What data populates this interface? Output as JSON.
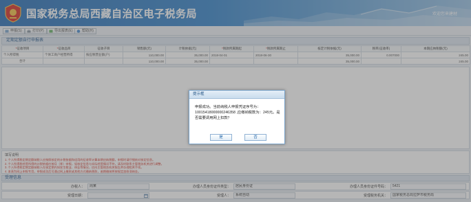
{
  "header": {
    "site_title": "国家税务总局西藏自治区电子税务局",
    "welcome": "欢迎您来建材"
  },
  "toolbar": {
    "buttons": [
      {
        "label": "申报(S)"
      },
      {
        "label": "打印(P)"
      },
      {
        "label": "导出报表(E)"
      },
      {
        "label": "帮助(H)"
      }
    ]
  },
  "form": {
    "title": "定期定额自行申报表",
    "columns": [
      "征收项目",
      "征收品目",
      "征收子目",
      "销售额(元)",
      "计税依据(元)",
      "税款所属期起",
      "税款所属期止",
      "核定计税依据(元)",
      "税率(征收率)",
      "本期应纳税额(元)"
    ],
    "rows": [
      {
        "cells": [
          "个人所得税",
          "个体工商户经营所得",
          "按应税营业额(户)",
          "110,000.00",
          "35,000.00",
          "2018-04-01",
          "2018-06-30",
          "35,000.00",
          "0.007000",
          "245.00"
        ]
      },
      {
        "cells": [
          "合计",
          "",
          "",
          "110,000.00",
          "35,000.00",
          "",
          "",
          "35,000.00",
          "",
          "245.00"
        ]
      }
    ]
  },
  "notes": {
    "title": "填写说明",
    "lines": [
      "1. 个人所得税定期定额纳税人应按照核定的计税依据和适用的征收率计算本期应纳税额，申报时请仔细核对核定信息。",
      "2. 个人所得税经营所得的计税依据应按月（季）申报，如核定信息与实际经营情况不符，请及时联系主管税务机关进行调整。",
      "3. 个人所得税定期定额纳税人在核定期内如发生歇业、停业等情况，应向主管税务机关报告并办理相关手续。",
      "4. 本表为网上申报专用，申报成功后可通过网上缴款或其他方式缴纳税款，逾期缴纳将按规定加收滞纳金。"
    ]
  },
  "acceptance": {
    "title": "受理信息",
    "row1": [
      {
        "label": "办税人：",
        "value": "周某"
      },
      {
        "label": "办理人员身份证件类型：",
        "value": "居民身份证"
      },
      {
        "label": "办理人员身份证件号码：",
        "value": "5421"
      }
    ],
    "row2": [
      {
        "label": "受理日期：",
        "value": ""
      },
      {
        "label": "受理人：",
        "value": "系统自动"
      },
      {
        "label": "受理税务机关：",
        "value": "国家税务总局拉萨市税务局"
      }
    ]
  },
  "dialog": {
    "title": "提示框",
    "message": "申报成功。当前纳税人申报凭证序号为：10015418000000246358 ,应缴纳税款为：245元。是否需要调用网上扣款？",
    "confirm_label": "是",
    "cancel_label": "否"
  },
  "colors": {
    "banner": "#3c88cc",
    "accent_red": "#e0312a",
    "dialog_border": "#7aa3c9"
  }
}
